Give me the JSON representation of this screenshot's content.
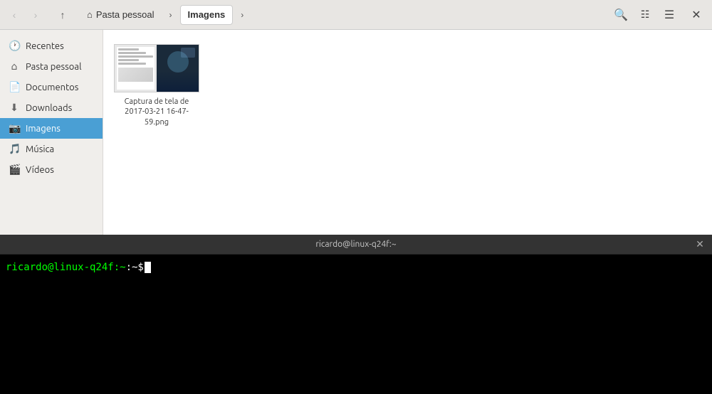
{
  "toolbar": {
    "back_btn": "‹",
    "forward_btn": "›",
    "up_btn": "⬆",
    "home_label": "Pasta pessoal",
    "current_folder": "Imagens",
    "arrow_right": "›",
    "search_icon": "🔍",
    "view_icon": "☰",
    "menu_icon": "≡",
    "close_icon": "✕"
  },
  "sidebar": {
    "items": [
      {
        "id": "recentes",
        "label": "Recentes",
        "icon": "🕐"
      },
      {
        "id": "pasta-pessoal",
        "label": "Pasta pessoal",
        "icon": "🏠"
      },
      {
        "id": "documentos",
        "label": "Documentos",
        "icon": "📄"
      },
      {
        "id": "downloads",
        "label": "Downloads",
        "icon": "⬇"
      },
      {
        "id": "imagens",
        "label": "Imagens",
        "icon": "🖼",
        "active": true
      },
      {
        "id": "musica",
        "label": "Música",
        "icon": "🎵"
      },
      {
        "id": "videos",
        "label": "Vídeos",
        "icon": "🎬"
      }
    ]
  },
  "files": [
    {
      "id": "screenshot",
      "name": "Captura de tela de 2017-03-21 16-47-59.png",
      "type": "image"
    }
  ],
  "terminal": {
    "title": "ricardo@linux-q24f:~",
    "prompt": "ricardo@linux-q24f:~$ ",
    "prompt_user": "ricardo@linux-q24f:~",
    "prompt_symbol": "$",
    "close_icon": "✕"
  }
}
